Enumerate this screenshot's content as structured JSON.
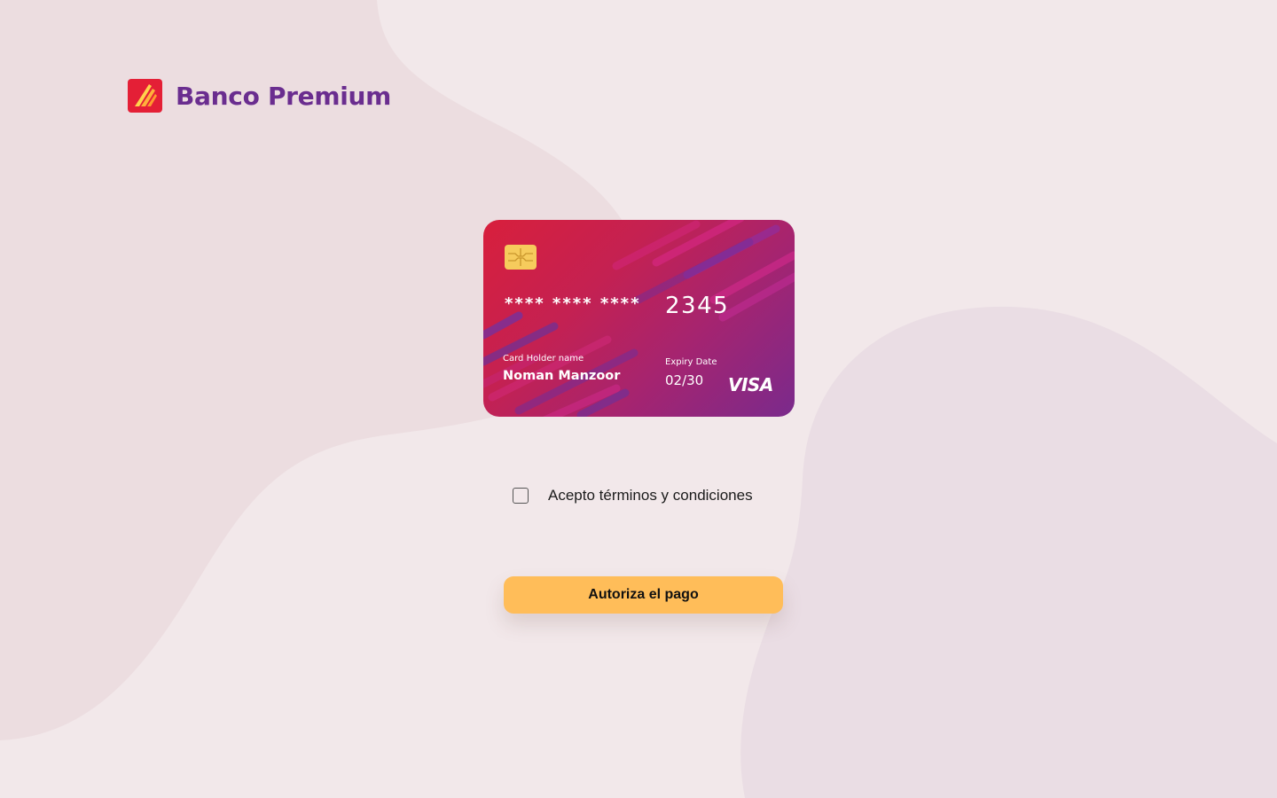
{
  "brand": {
    "name": "Banco Premium",
    "logo_icon": "bank-logo-icon",
    "accent_color": "#6a2d8f",
    "logo_color": "#e41f36"
  },
  "card": {
    "masked_groups": "****  ****  ****",
    "last4": "2345",
    "holder_label": "Card Holder name",
    "holder_name": "Noman Manzoor",
    "expiry_label": "Expiry Date",
    "expiry_value": "02/30",
    "network": "VISA",
    "chip_icon": "chip-icon"
  },
  "terms": {
    "label": "Acepto términos y condiciones",
    "checked": false
  },
  "actions": {
    "pay_label": "Autoriza el pago",
    "pay_color": "#ffbd59"
  }
}
